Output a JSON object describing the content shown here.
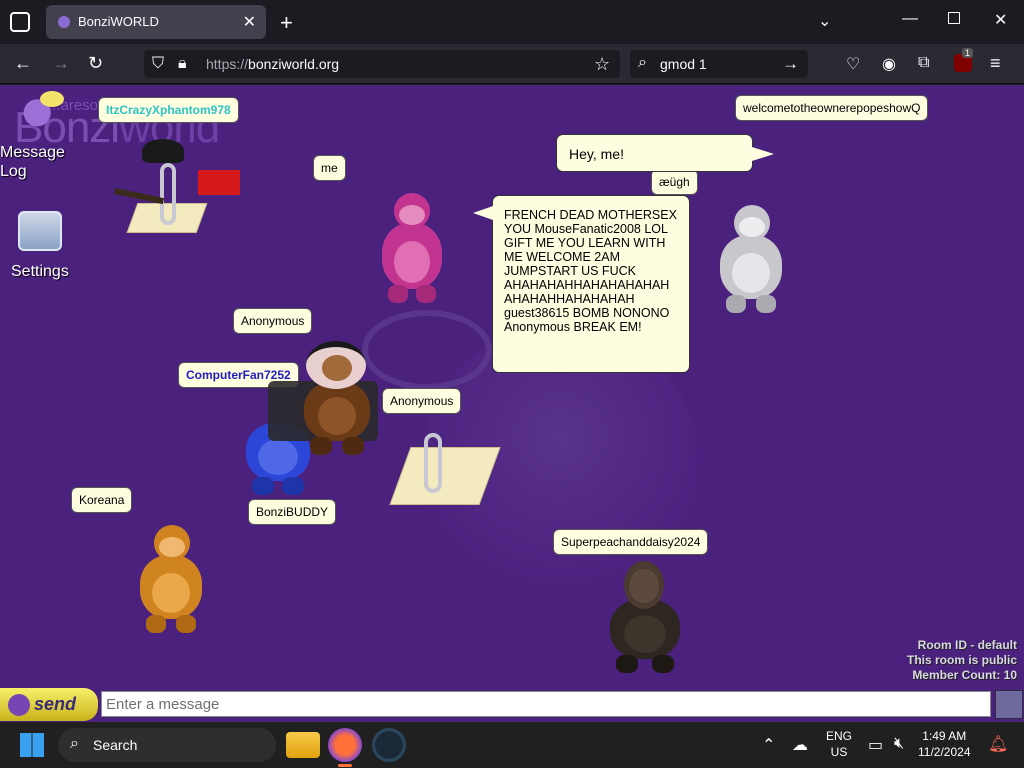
{
  "browser": {
    "tab_title": "BonziWORLD",
    "url_prefix": "https://",
    "url_host": "bonziworld.org",
    "search_value": "gmod 1",
    "extension_badge": "1"
  },
  "site": {
    "logo_small": "...areso",
    "logo_text": "Bonzi",
    "logo_text2": "world"
  },
  "sidebar": {
    "message_log_label_1": "Message",
    "message_log_label_2": "Log",
    "settings_label": "Settings"
  },
  "users": [
    {
      "name": "ItzCrazyXphantom978",
      "color": "#2ec4c4"
    },
    {
      "name": "me"
    },
    {
      "name": "Anonymous"
    },
    {
      "name": "ComputerFan7252",
      "color": "#2020c0"
    },
    {
      "name": "Anonymous"
    },
    {
      "name": "Koreana"
    },
    {
      "name": "BonziBUDDY"
    },
    {
      "name": "Superpeachanddaisy2024"
    },
    {
      "name": "welcometotheownerepopeshowQ"
    },
    {
      "name": "æügh"
    }
  ],
  "bubbles": {
    "hey": "Hey, me!",
    "french": "FRENCH DEAD MOTHERSEX YOU MouseFanatic2008 LOL GIFT ME YOU LEARN WITH ME WELCOME 2AM JUMPSTART US FUCK AHAHAHAHHAHAHAHAHAH AHAHAHHAHAHAHAH guest38615 BOMB NONONO Anonymous BREAK EM!"
  },
  "room": {
    "id_line": "Room ID - default",
    "public_line": "This room is public",
    "count_line": "Member Count: 10"
  },
  "chat": {
    "send_label": "send",
    "input_placeholder": "Enter a message"
  },
  "taskbar": {
    "search_label": "Search",
    "lang_1": "ENG",
    "lang_2": "US",
    "time": "1:49 AM",
    "date": "11/2/2024"
  },
  "colors": {
    "page_bg": "#4b217e",
    "bubble_bg": "#fffde0"
  }
}
